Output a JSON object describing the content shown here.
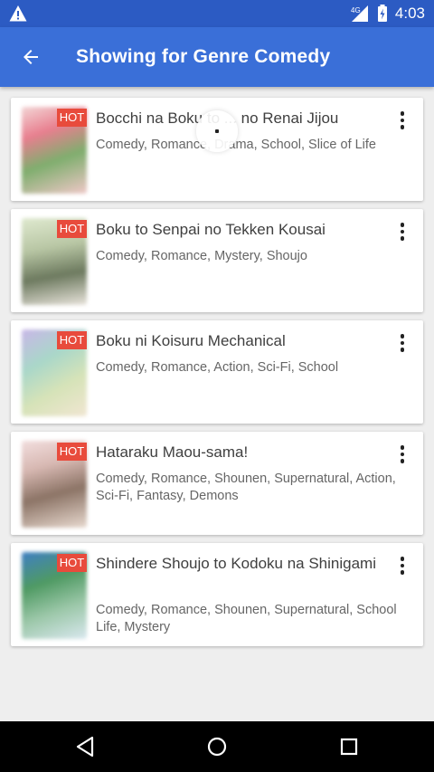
{
  "status_bar": {
    "network": "4G",
    "time": "4:03"
  },
  "app_bar": {
    "title": "Showing for Genre Comedy"
  },
  "badge_label": "HOT",
  "items": [
    {
      "title": "Bocchi na Boku to ... no Renai Jijou",
      "genres": "Comedy, Romance, Drama, School, Slice of Life"
    },
    {
      "title": "Boku to Senpai no Tekken Kousai",
      "genres": "Comedy, Romance, Mystery, Shoujo"
    },
    {
      "title": "Boku ni Koisuru Mechanical",
      "genres": "Comedy, Romance, Action, Sci-Fi, School"
    },
    {
      "title": "Hataraku Maou-sama!",
      "genres": "Comedy, Romance, Shounen, Supernatural, Action, Sci-Fi, Fantasy, Demons"
    },
    {
      "title": "Shindere Shoujo to Kodoku na Shinigami",
      "genres": "Comedy, Romance, Shounen, Supernatural, School Life, Mystery"
    }
  ],
  "icons": {
    "status_warning": "warning-icon",
    "signal": "signal-icon",
    "battery": "battery-icon",
    "back": "arrow-left-icon",
    "menu": "more-vert-icon",
    "nav_back": "triangle-back-icon",
    "nav_home": "circle-home-icon",
    "nav_recents": "square-recents-icon"
  },
  "colors": {
    "status_bar": "#2c5bc3",
    "app_bar": "#3a6fd8",
    "badge": "#e84b3c",
    "background": "#eeeeee"
  }
}
